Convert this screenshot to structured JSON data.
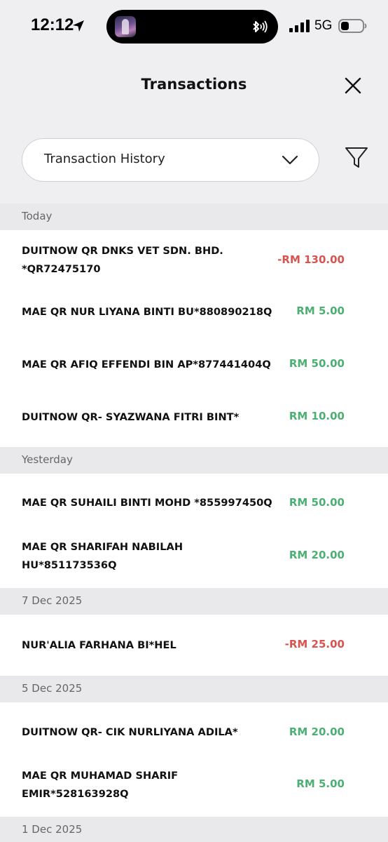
{
  "status_bar": {
    "time": "12:12",
    "network": "5G"
  },
  "header": {
    "title": "Transactions"
  },
  "dropdown": {
    "selected": "Transaction History"
  },
  "sections": [
    {
      "label": "Today",
      "items": [
        {
          "description": "DUITNOW QR DNKS VET SDN. BHD. *QR72475170",
          "amount": "-RM 130.00",
          "type": "debit"
        },
        {
          "description": "MAE QR NUR LIYANA BINTI BU*880890218Q",
          "amount": "RM 5.00",
          "type": "credit"
        },
        {
          "description": "MAE QR AFIQ EFFENDI BIN AP*877441404Q",
          "amount": "RM 50.00",
          "type": "credit"
        },
        {
          "description": "DUITNOW QR- SYAZWANA FITRI BINT*",
          "amount": "RM 10.00",
          "type": "credit"
        }
      ]
    },
    {
      "label": "Yesterday",
      "items": [
        {
          "description": "MAE QR SUHAILI BINTI MOHD *855997450Q",
          "amount": "RM 50.00",
          "type": "credit"
        },
        {
          "description": "MAE QR SHARIFAH NABILAH HU*851173536Q",
          "amount": "RM 20.00",
          "type": "credit"
        }
      ]
    },
    {
      "label": "7 Dec 2025",
      "items": [
        {
          "description": "NUR'ALIA FARHANA BI*HEL",
          "amount": "-RM 25.00",
          "type": "debit"
        }
      ]
    },
    {
      "label": "5 Dec 2025",
      "items": [
        {
          "description": "DUITNOW QR- CIK NURLIYANA ADILA*",
          "amount": "RM 20.00",
          "type": "credit"
        },
        {
          "description": "MAE QR MUHAMAD SHARIF EMIR*528163928Q",
          "amount": "RM 5.00",
          "type": "credit"
        }
      ]
    },
    {
      "label": "1 Dec 2025",
      "items": []
    }
  ],
  "colors": {
    "debit": "#d9534f",
    "credit": "#4caf73",
    "section_bg": "#e9e9eb",
    "header_bg": "#efeff1"
  }
}
